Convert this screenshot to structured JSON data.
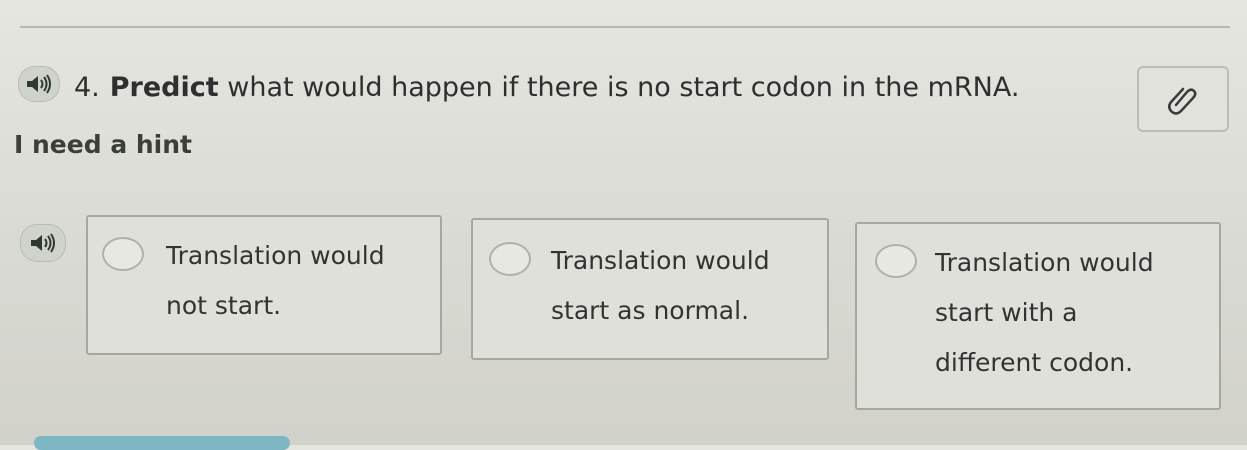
{
  "question": {
    "number": "4.",
    "keyword": "Predict",
    "text": " what would happen if there is no start codon in the mRNA."
  },
  "hint": {
    "label": "I need a hint"
  },
  "icons": {
    "question_audio": "speaker-icon",
    "choices_audio": "speaker-icon",
    "tool": "paperclip-icon"
  },
  "choices": [
    {
      "text": "Translation would not start."
    },
    {
      "text": "Translation would start as normal."
    },
    {
      "text": "Translation would start with a different codon."
    }
  ],
  "colors": {
    "accent": "#7fb6c4",
    "text": "#2f2f2f"
  }
}
